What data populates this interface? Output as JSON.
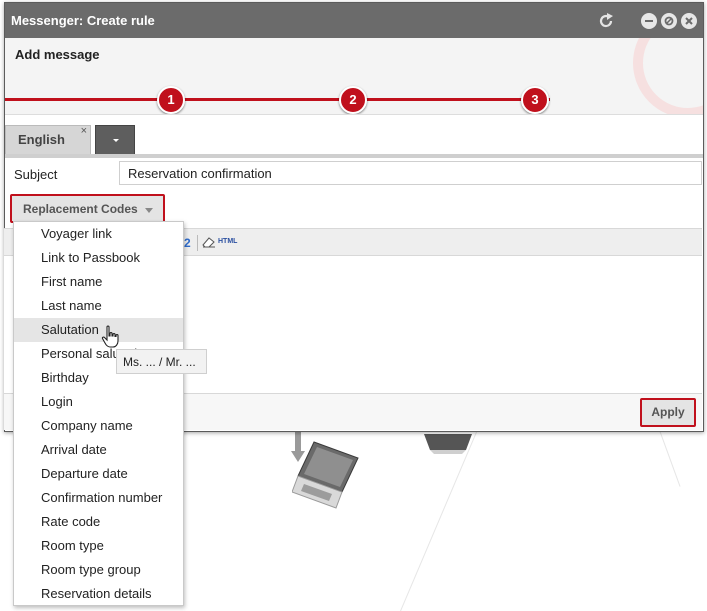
{
  "window": {
    "title": "Messenger: Create rule"
  },
  "header": {
    "heading": "Add message",
    "steps": [
      "1",
      "2",
      "3"
    ]
  },
  "tabs": {
    "language_tab": "English",
    "close_glyph": "×"
  },
  "form": {
    "subject_label": "Subject",
    "subject_value": "Reservation confirmation"
  },
  "replacement_codes": {
    "button_label": "Replacement Codes",
    "items": [
      "Voyager link",
      "Link to Passbook",
      "First name",
      "Last name",
      "Salutation",
      "Personal salutation",
      "Birthday",
      "Login",
      "Company name",
      "Arrival date",
      "Departure date",
      "Confirmation number",
      "Rate code",
      "Room type",
      "Room type group",
      "Reservation details"
    ],
    "hovered_item": "Salutation",
    "tooltip": "Ms. ... / Mr. ..."
  },
  "editor": {
    "html_label": "HTML"
  },
  "footer": {
    "apply_label": "Apply"
  },
  "colors": {
    "titlebar": "#6b6b6b",
    "accent_red": "#c0101c"
  },
  "icons": {
    "refresh": "refresh-icon",
    "minimize": "minimize-icon",
    "maximize": "maximize-icon",
    "close": "close-icon"
  }
}
